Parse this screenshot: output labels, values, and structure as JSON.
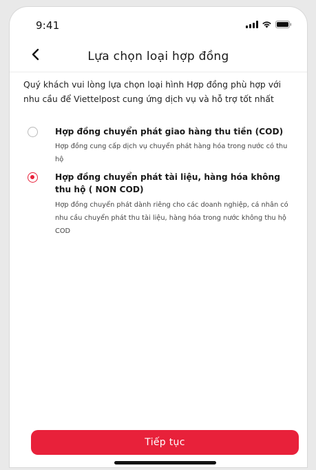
{
  "status_bar": {
    "time": "9:41",
    "icons": [
      "signal-icon",
      "wifi-icon",
      "battery-icon"
    ]
  },
  "nav": {
    "back_icon": "chevron-left-icon",
    "title": "Lựa chọn loại hợp đồng"
  },
  "intro": "Quý khách vui lòng lựa chọn loại hình Hợp đồng phù hợp với nhu cầu để Viettelpost cung ứng dịch vụ và hỗ trợ tốt nhất",
  "options": [
    {
      "title": "Hợp đồng chuyển phát giao hàng thu tiền (COD)",
      "description": "Hợp đồng cung cấp dịch vụ chuyển phát hàng hóa trong nước có thu hộ",
      "selected": false
    },
    {
      "title": "Hợp đồng chuyển phát tài liệu, hàng hóa không thu hộ ( NON COD)",
      "description": "Hợp đồng chuyển phát dành riêng cho các doanh nghiệp, cá nhân có nhu cầu chuyển phát thu tài liệu, hàng hóa trong nước không thu hộ COD",
      "selected": true
    }
  ],
  "continue_label": "Tiếp tục",
  "colors": {
    "accent": "#e8213a",
    "text": "#1a1a1a",
    "radio_unselected": "#b9b9b9"
  }
}
